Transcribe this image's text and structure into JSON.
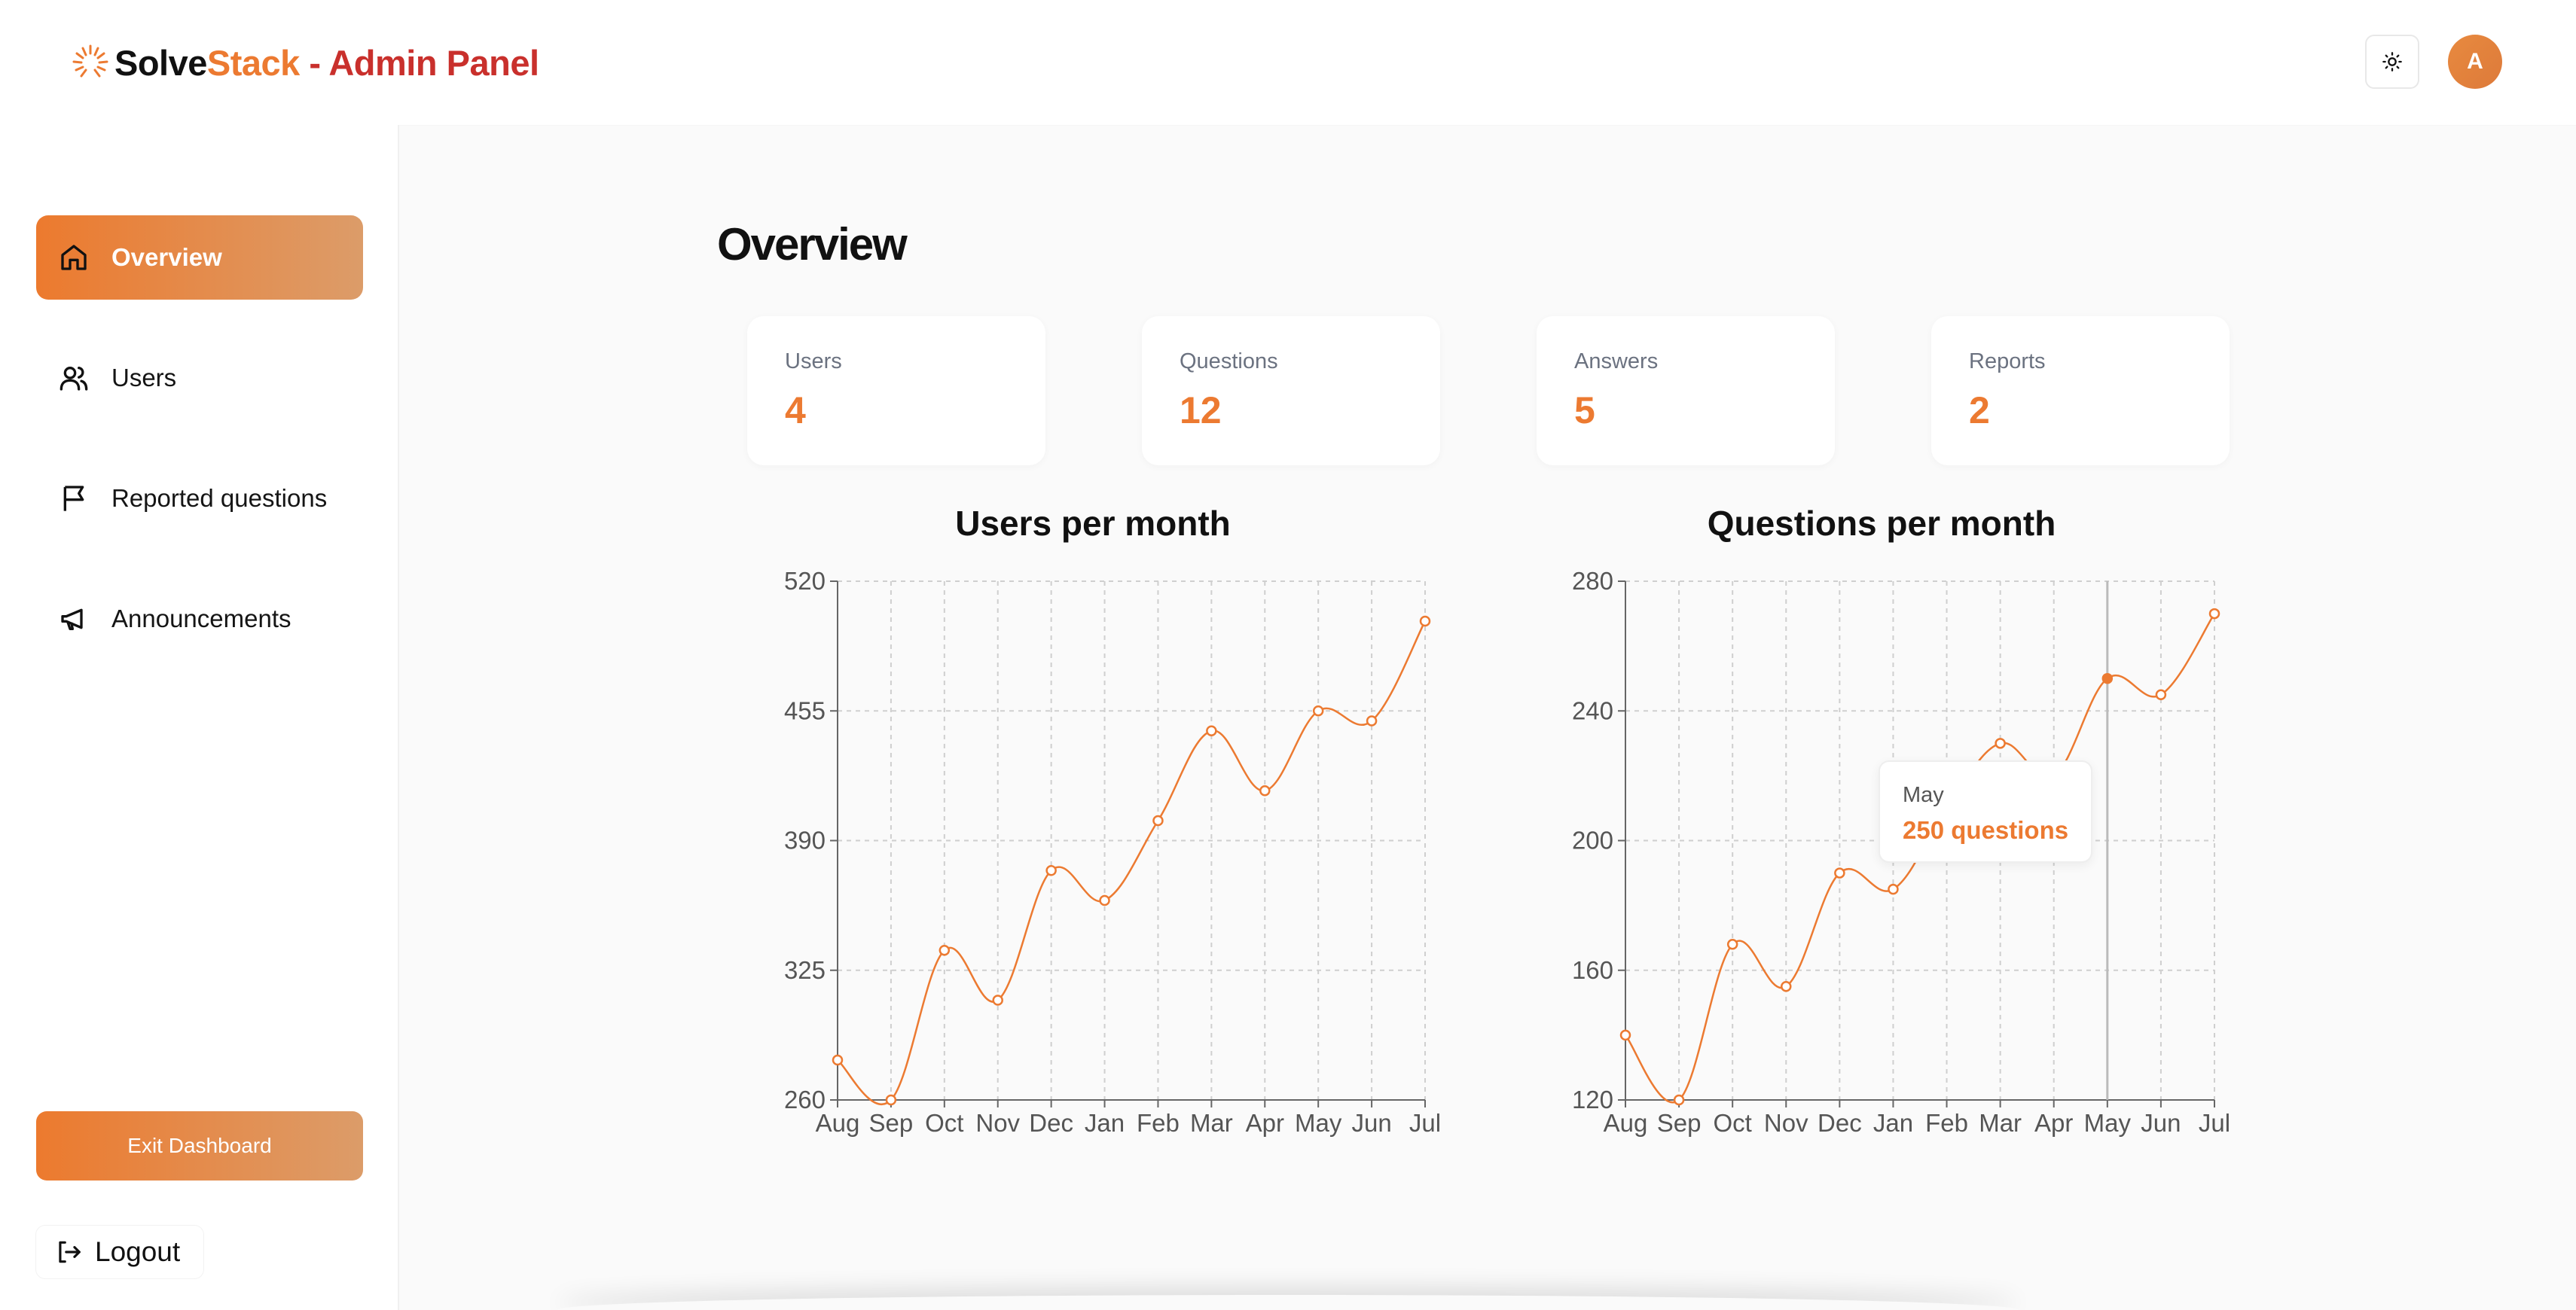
{
  "header": {
    "logo_word_1": "Solve",
    "logo_word_2": "Stack",
    "logo_suffix": " - Admin Panel",
    "avatar_initial": "A",
    "theme_icon": "sun-icon"
  },
  "sidebar": {
    "items": [
      {
        "label": "Overview",
        "icon": "home-icon",
        "active": true
      },
      {
        "label": "Users",
        "icon": "users-icon",
        "active": false
      },
      {
        "label": "Reported questions",
        "icon": "flag-icon",
        "active": false
      },
      {
        "label": "Announcements",
        "icon": "megaphone-icon",
        "active": false
      }
    ],
    "exit_label": "Exit Dashboard",
    "logout_label": "Logout"
  },
  "main": {
    "title": "Overview",
    "stats": [
      {
        "label": "Users",
        "value": "4"
      },
      {
        "label": "Questions",
        "value": "12"
      },
      {
        "label": "Answers",
        "value": "5"
      },
      {
        "label": "Reports",
        "value": "2"
      }
    ]
  },
  "colors": {
    "accent": "#ec7a31",
    "accent_light": "#dc9c69",
    "brand_red": "#c9302c"
  },
  "tooltip": {
    "label": "May",
    "value": "250 questions"
  },
  "chart_data": [
    {
      "type": "line",
      "title": "Users per month",
      "categories": [
        "Aug",
        "Sep",
        "Oct",
        "Nov",
        "Dec",
        "Jan",
        "Feb",
        "Mar",
        "Apr",
        "May",
        "Jun",
        "Jul"
      ],
      "values": [
        280,
        260,
        335,
        310,
        375,
        360,
        400,
        445,
        415,
        455,
        450,
        500
      ],
      "yticks": [
        260,
        325,
        390,
        455,
        520
      ],
      "ylim": [
        260,
        520
      ],
      "grid": true
    },
    {
      "type": "line",
      "title": "Questions per month",
      "categories": [
        "Aug",
        "Sep",
        "Oct",
        "Nov",
        "Dec",
        "Jan",
        "Feb",
        "Mar",
        "Apr",
        "May",
        "Jun",
        "Jul"
      ],
      "values": [
        140,
        120,
        168,
        155,
        190,
        185,
        210,
        230,
        220,
        250,
        245,
        270
      ],
      "yticks": [
        120,
        160,
        200,
        240,
        280
      ],
      "ylim": [
        120,
        280
      ],
      "grid": true,
      "highlight_index": 9
    }
  ]
}
